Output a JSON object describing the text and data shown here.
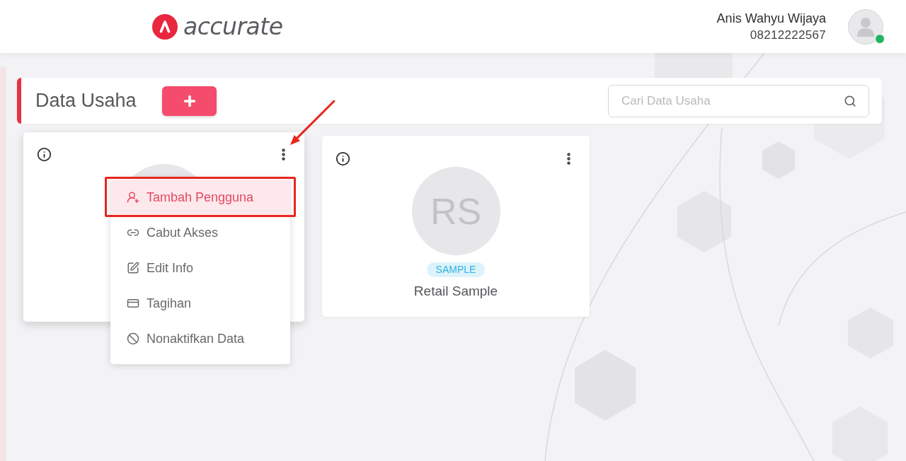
{
  "header": {
    "logo": {
      "text": "accurate"
    },
    "user": {
      "name": "Anis Wahyu Wijaya",
      "phone": "08212222567",
      "online": true
    }
  },
  "toolbar": {
    "title": "Data Usaha",
    "search": {
      "placeholder": "Cari Data Usaha"
    }
  },
  "businesses": [
    {
      "menu_open": true,
      "menu": [
        {
          "label": "Tambah Pengguna",
          "selected": true
        },
        {
          "label": "Cabut Akses",
          "selected": false
        },
        {
          "label": "Edit Info",
          "selected": false
        },
        {
          "label": "Tagihan",
          "selected": false
        },
        {
          "label": "Nonaktifkan Data",
          "selected": false
        }
      ]
    },
    {
      "initials": "RS",
      "badge": "SAMPLE",
      "name": "Retail Sample",
      "menu_open": false
    }
  ]
}
